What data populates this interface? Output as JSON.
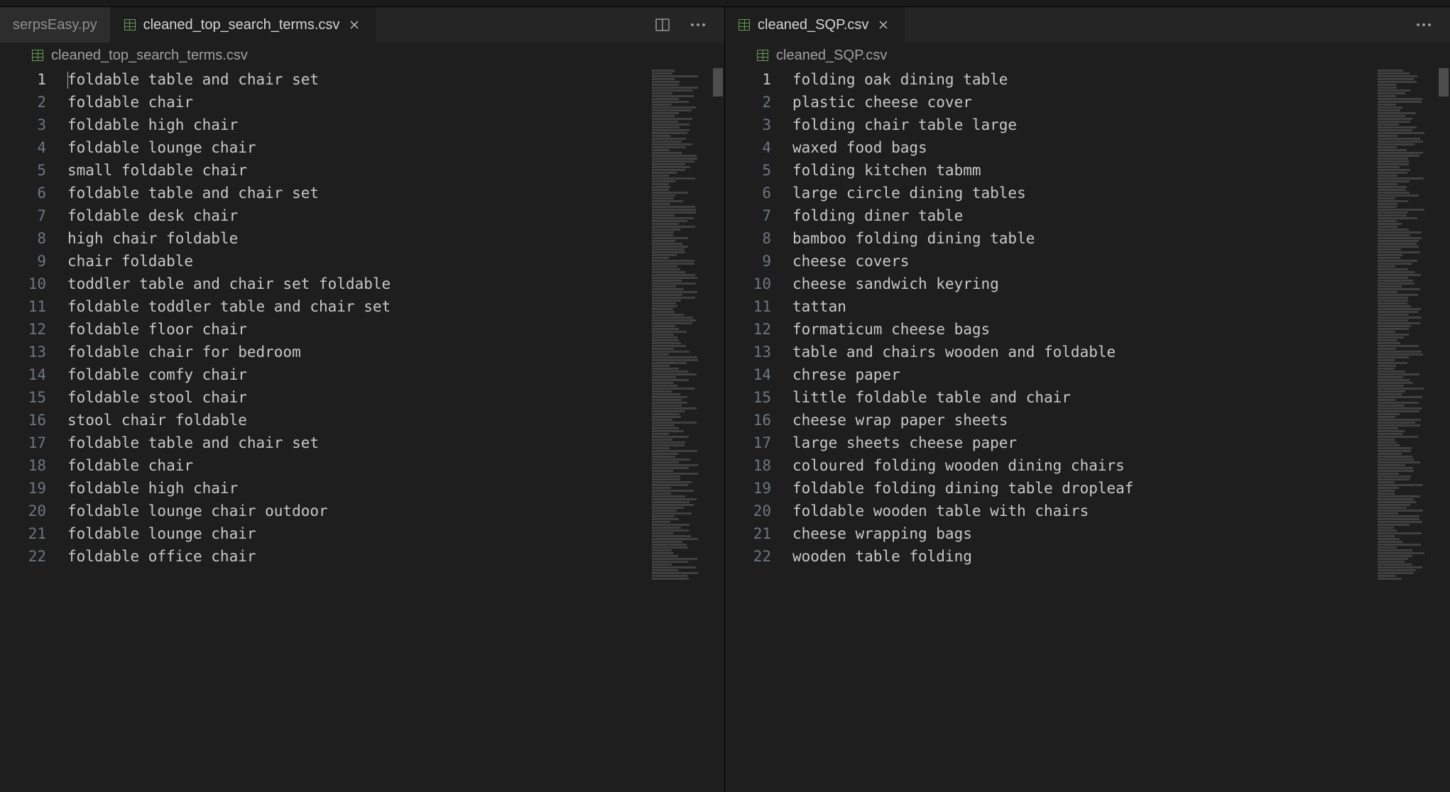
{
  "tabs": {
    "left": [
      {
        "label": "serpsEasy.py",
        "active": false,
        "icon": "none",
        "closeable": false
      },
      {
        "label": "cleaned_top_search_terms.csv",
        "active": true,
        "icon": "csv",
        "closeable": true
      }
    ],
    "right": [
      {
        "label": "cleaned_SQP.csv",
        "active": true,
        "icon": "csv",
        "closeable": true
      }
    ]
  },
  "breadcrumbs": {
    "left": "cleaned_top_search_terms.csv",
    "right": "cleaned_SQP.csv"
  },
  "files": {
    "left_lines": [
      "foldable table and chair set",
      "foldable chair",
      "foldable high chair",
      "foldable lounge chair",
      "small foldable chair",
      "foldable table and chair set",
      "foldable desk chair",
      "high chair foldable",
      "chair foldable",
      "toddler table and chair set foldable",
      "foldable toddler table and chair set",
      "foldable floor chair",
      "foldable chair for bedroom",
      "foldable comfy chair",
      "foldable stool chair",
      "stool chair foldable",
      "foldable table and chair set",
      "foldable chair",
      "foldable high chair",
      "foldable lounge chair outdoor",
      "foldable lounge chair",
      "foldable office chair"
    ],
    "right_lines": [
      "folding oak dining table",
      "plastic cheese cover",
      "folding chair table large",
      "waxed food bags",
      "folding kitchen tabmm",
      "large circle dining tables",
      "folding diner table",
      "bamboo folding dining table",
      "cheese covers",
      "cheese sandwich keyring",
      "tattan",
      "formaticum cheese bags",
      "table and chairs wooden and foldable",
      "chrese paper",
      "little foldable table and chair",
      "cheese wrap paper sheets",
      "large sheets cheese paper",
      "coloured folding wooden dining chairs",
      "foldable folding dining table dropleaf",
      "foldable wooden table with chairs",
      "cheese wrapping bags",
      "wooden table folding"
    ]
  }
}
